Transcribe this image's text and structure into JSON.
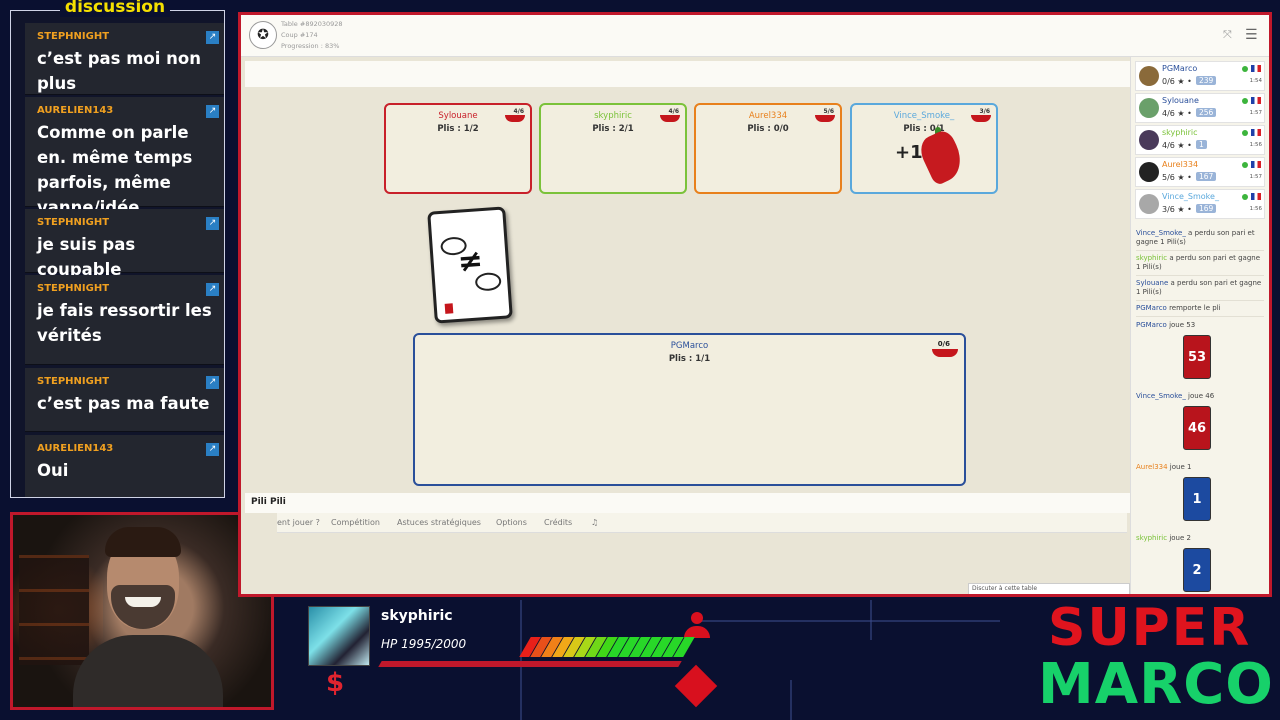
{
  "chat": {
    "title": "discussion",
    "messages": [
      {
        "user": "STEPHNIGHT",
        "text": "c’est pas moi non plus"
      },
      {
        "user": "AURELIEN143",
        "text": "Comme on parle en. même temps parfois, même vanne/idée"
      },
      {
        "user": "STEPHNIGHT",
        "text": "je suis pas coupable"
      },
      {
        "user": "STEPHNIGHT",
        "text": "je fais ressortir les vérités"
      },
      {
        "user": "STEPHNIGHT",
        "text": "c’est pas ma faute"
      },
      {
        "user": "AURELIEN143",
        "text": "Oui"
      }
    ]
  },
  "game": {
    "table": "Table #892030928",
    "coup": "Coup #174",
    "progression": "Progression : 83%",
    "title": "Pili Pili",
    "plus_one": "+1",
    "card_symbol": "≠",
    "opponents": [
      {
        "name": "Sylouane",
        "plis": "Plis : 1/2",
        "bet": "4/6",
        "color": "#c8202a"
      },
      {
        "name": "skyphiric",
        "plis": "Plis : 2/1",
        "bet": "4/6",
        "color": "#7bc23a"
      },
      {
        "name": "Aurel334",
        "plis": "Plis : 0/0",
        "bet": "5/6",
        "color": "#e8801c"
      },
      {
        "name": "Vince_Smoke_",
        "plis": "Plis : 0/1",
        "bet": "3/6",
        "color": "#5aa8dc"
      }
    ],
    "me": {
      "name": "PGMarco",
      "plis": "Plis : 1/1",
      "bet": "0/6"
    },
    "nav": [
      "ent jouer ?",
      "Compétition",
      "Astuces stratégiques",
      "Options",
      "Crédits",
      "♫"
    ],
    "chat_input_placeholder": "Discuter à cette table"
  },
  "sidebar": {
    "players": [
      {
        "name": "PGMarco",
        "score": "0/6 ★ •",
        "points": "239",
        "time": "1:54",
        "color": "#2a4f9a"
      },
      {
        "name": "Sylouane",
        "score": "4/6 ★ •",
        "points": "256",
        "time": "1:57",
        "color": "#2a4f9a"
      },
      {
        "name": "skyphiric",
        "score": "4/6 ★ •",
        "points": "1",
        "time": "1:56",
        "color": "#7bc23a"
      },
      {
        "name": "Aurel334",
        "score": "5/6 ★ •",
        "points": "167",
        "time": "1:57",
        "color": "#e8801c"
      },
      {
        "name": "Vince_Smoke_",
        "score": "3/6 ★ •",
        "points": "169",
        "time": "1:56",
        "color": "#5aa8dc"
      }
    ],
    "log": [
      {
        "who": "Vince_Smoke_",
        "text": " a perdu son pari et gagne 1 Pili(s)"
      },
      {
        "who": "skyphiric",
        "text": " a perdu son pari et gagne 1 Pili(s)"
      },
      {
        "who": "Sylouane",
        "text": " a perdu son pari et gagne 1 Pili(s)"
      },
      {
        "who": "PGMarco",
        "text": " remporte le pli"
      },
      {
        "who": "PGMarco",
        "text": " joue 53"
      },
      {
        "who": "Vince_Smoke_",
        "text": " joue 46"
      },
      {
        "who": "Aurel334",
        "text": " joue 1"
      },
      {
        "who": "skyphiric",
        "text": " joue 2"
      }
    ],
    "played_cards": [
      {
        "value": "53",
        "color": "#b8141c"
      },
      {
        "value": "46",
        "color": "#b8141c"
      },
      {
        "value": "1",
        "color": "#1c4aa0"
      },
      {
        "value": "2",
        "color": "#1c4aa0"
      }
    ]
  },
  "hud": {
    "name": "skyphiric",
    "hp": "HP 1995/2000",
    "hp_fraction": 0.9975,
    "money_symbol": "$"
  },
  "brand": {
    "line1": "SUPER",
    "line2": "MARCO"
  }
}
